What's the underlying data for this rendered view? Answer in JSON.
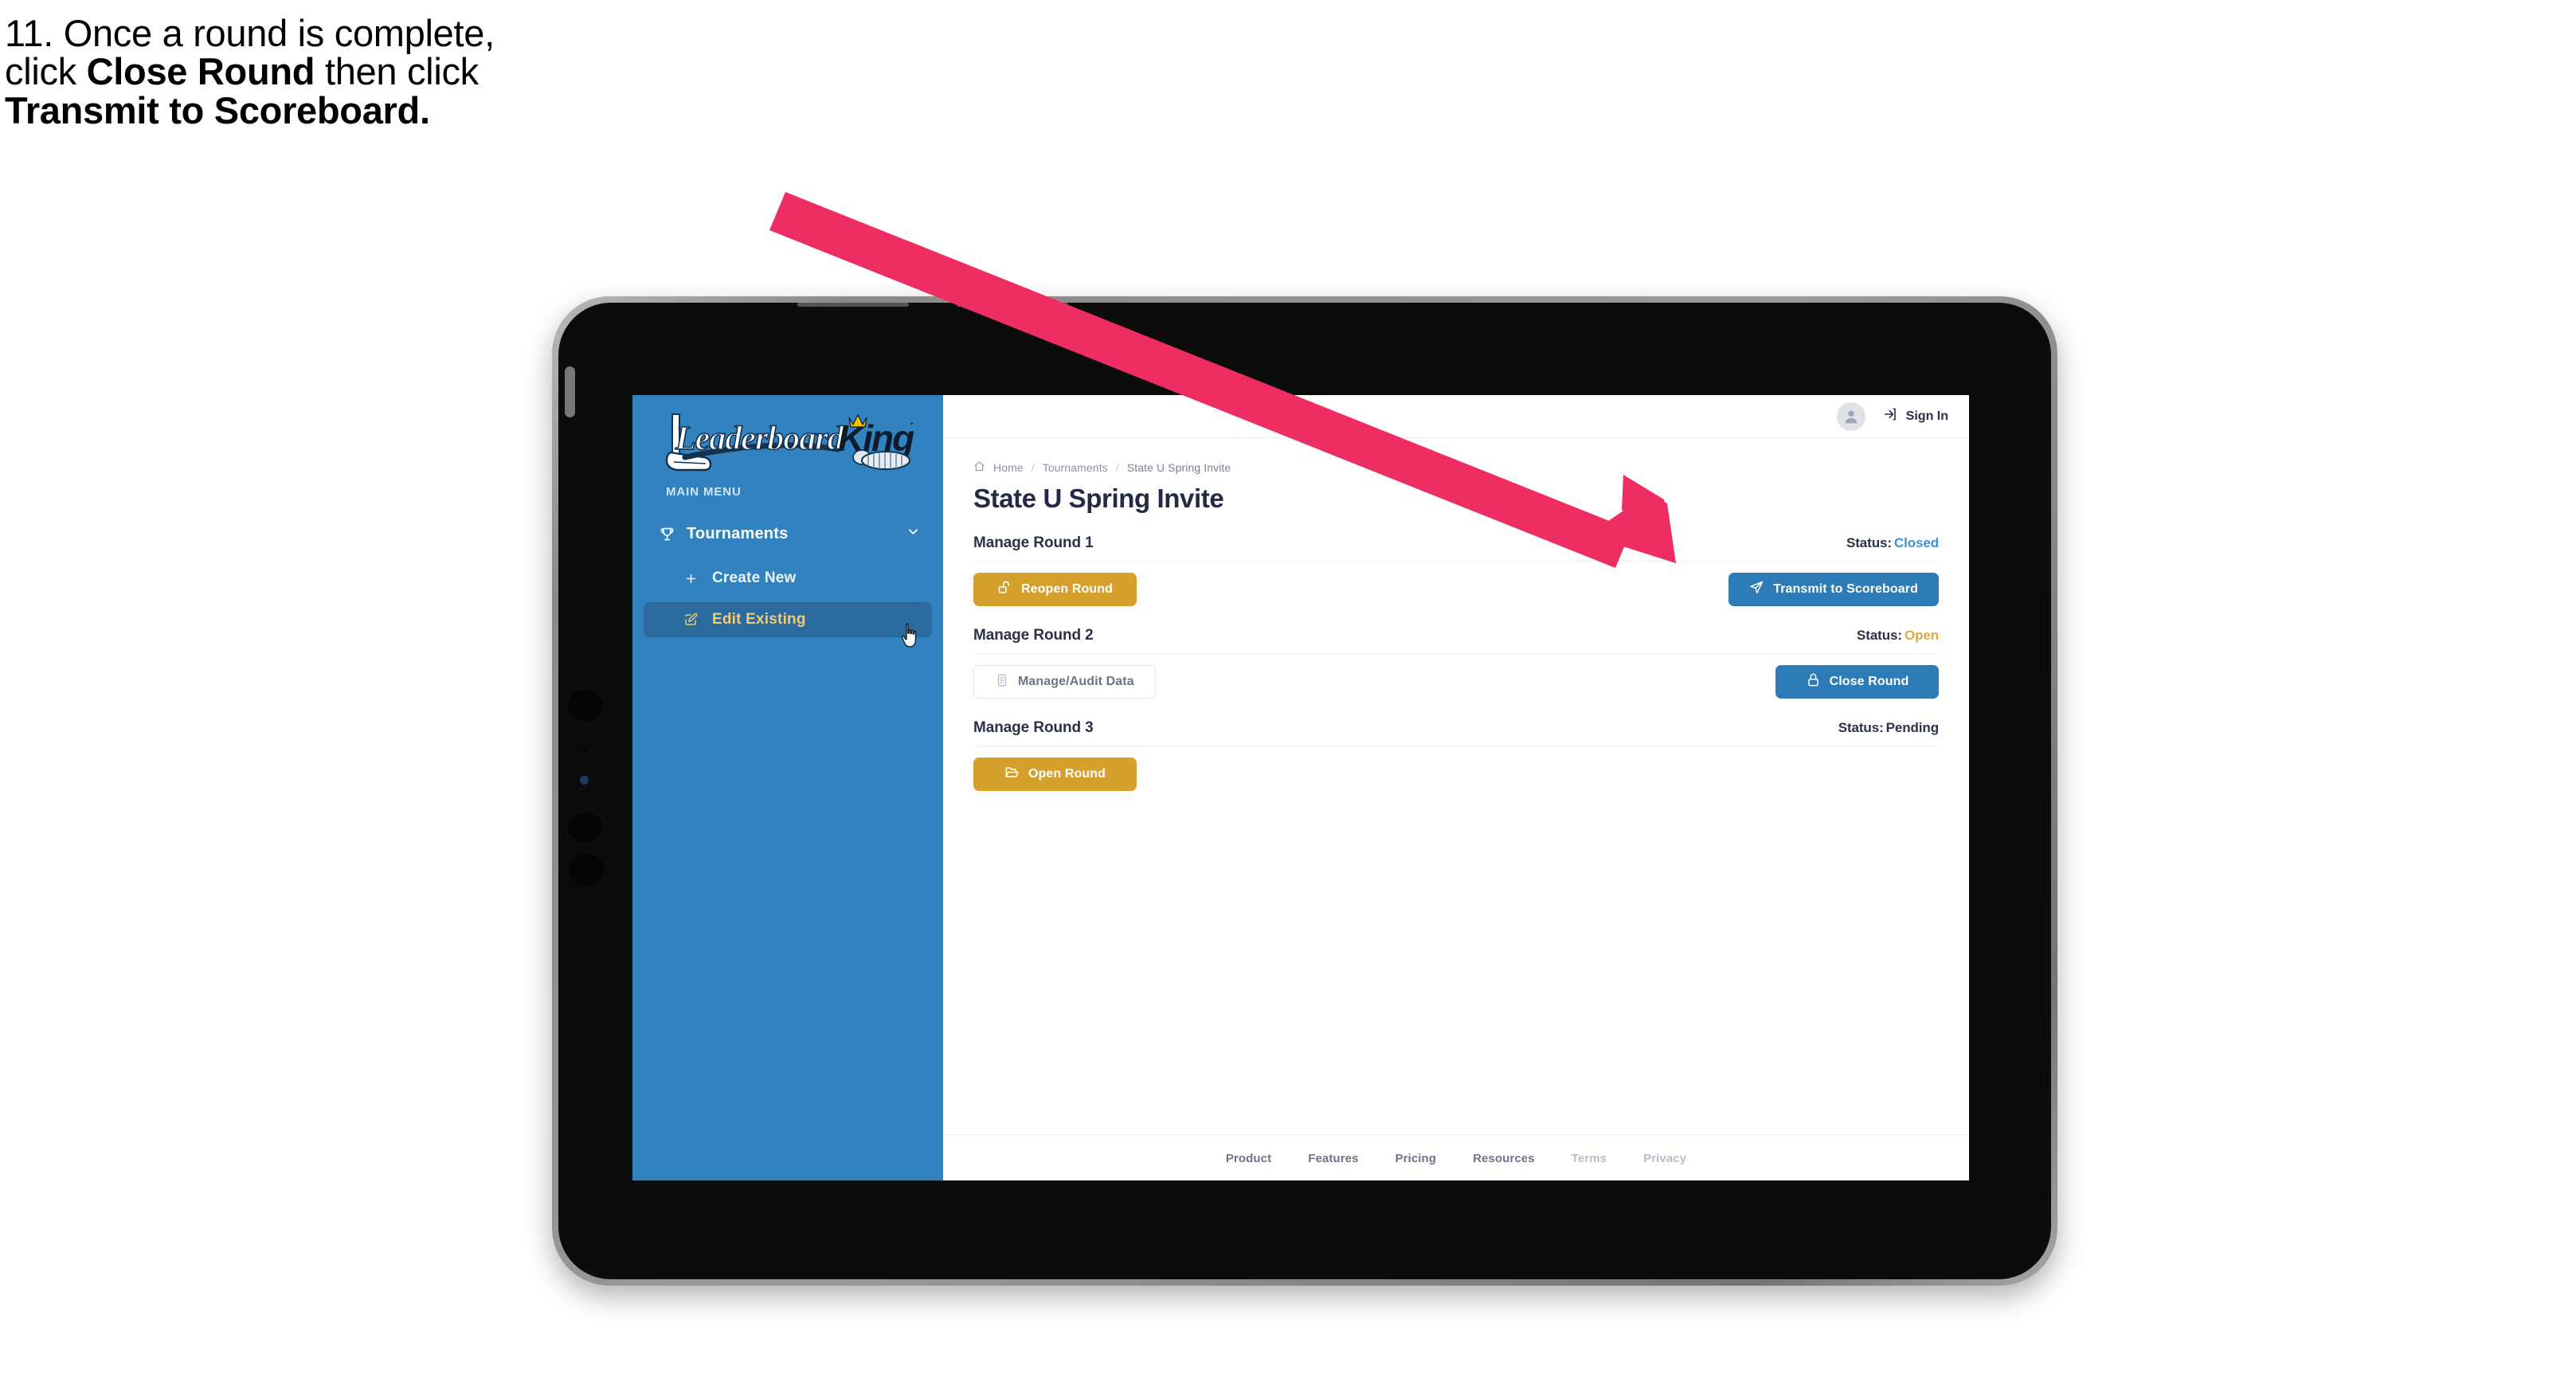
{
  "instruction": {
    "step_number": "11.",
    "line1_pre": "11. Once a round is complete,",
    "line2_pre": "click ",
    "line2_bold": "Close Round",
    "line2_post": " then click",
    "line3_bold": "Transmit to Scoreboard.",
    "arrow_color": "#ee2e62"
  },
  "app": {
    "brand": {
      "name_left": "Leaderboard",
      "name_right": "King",
      "sidebar_color": "#3182bf",
      "accent_gold": "#d6a02c",
      "accent_blue": "#2d7cb8"
    },
    "sidebar": {
      "section_label": "MAIN MENU",
      "items": [
        {
          "id": "tournaments",
          "label": "Tournaments",
          "icon": "trophy-icon",
          "expand_icon": "chevron-down-icon",
          "active": false
        },
        {
          "id": "create-new",
          "label": "Create New",
          "icon": "plus-icon",
          "active": false
        },
        {
          "id": "edit-existing",
          "label": "Edit Existing",
          "icon": "pencil-square-icon",
          "active": true
        }
      ]
    },
    "topbar": {
      "avatar_icon": "user-avatar-icon",
      "signin_icon": "sign-in-icon",
      "signin_label": "Sign In"
    },
    "breadcrumb": {
      "home_icon": "home-icon",
      "items": [
        "Home",
        "Tournaments",
        "State U Spring Invite"
      ],
      "separator": "/"
    },
    "page_title": "State U Spring Invite",
    "rounds": [
      {
        "title": "Manage Round 1",
        "status_label": "Status:",
        "status_value": "Closed",
        "status_color": "#3e8fd4",
        "left_button": {
          "label": "Reopen Round",
          "icon": "unlock-icon",
          "style": "gold"
        },
        "right_button": {
          "label": "Transmit to Scoreboard",
          "icon": "paper-plane-icon",
          "style": "blue"
        }
      },
      {
        "title": "Manage Round 2",
        "status_label": "Status:",
        "status_value": "Open",
        "status_color": "#e0a83b",
        "left_button": {
          "label": "Manage/Audit Data",
          "icon": "clipboard-icon",
          "style": "ghost"
        },
        "right_button": {
          "label": "Close Round",
          "icon": "lock-icon",
          "style": "blue"
        }
      },
      {
        "title": "Manage Round 3",
        "status_label": "Status:",
        "status_value": "Pending",
        "status_color": "#2b3149",
        "left_button": {
          "label": "Open Round",
          "icon": "folder-open-icon",
          "style": "gold"
        },
        "right_button": null
      }
    ],
    "footer": {
      "links": [
        {
          "label": "Product",
          "muted": false
        },
        {
          "label": "Features",
          "muted": false
        },
        {
          "label": "Pricing",
          "muted": false
        },
        {
          "label": "Resources",
          "muted": false
        },
        {
          "label": "Terms",
          "muted": true
        },
        {
          "label": "Privacy",
          "muted": true
        }
      ]
    }
  }
}
